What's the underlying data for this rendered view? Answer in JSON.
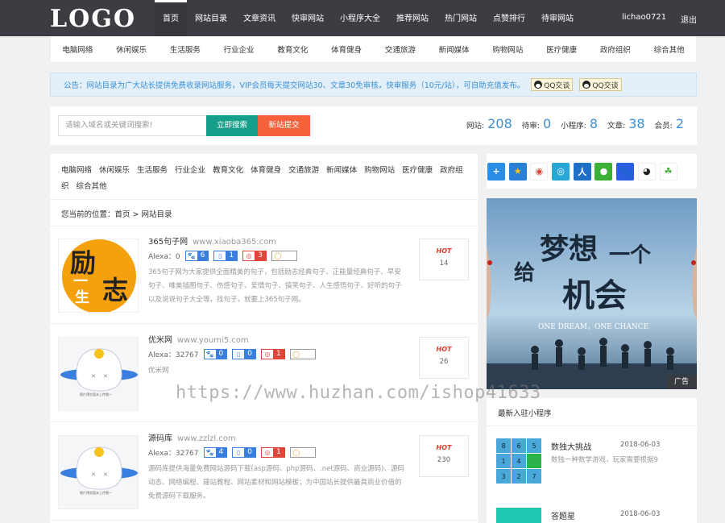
{
  "header": {
    "logo": "LOGO",
    "nav": [
      "首页",
      "网站目录",
      "文章资讯",
      "快审网站",
      "小程序大全",
      "推荐网站",
      "热门网站",
      "点赞排行",
      "待审网站"
    ],
    "active_index": 0,
    "user": "lichao0721",
    "logout": "退出"
  },
  "categories": [
    "电脑网络",
    "休闲娱乐",
    "生活服务",
    "行业企业",
    "教育文化",
    "体育健身",
    "交通旅游",
    "新闻媒体",
    "购物网站",
    "医疗健康",
    "政府组织",
    "综合其他"
  ],
  "notice": {
    "text": "公告：网站目录为广大站长提供免费收录网站服务，VIP会员每天提交网站30、文章30免审核，快审服务（10元/站），可自助充值发布。",
    "qq_buttons": [
      "QQ交谈",
      "QQ交谈"
    ]
  },
  "search": {
    "placeholder": "请输入域名或关键词搜索!",
    "search_label": "立即搜索",
    "submit_label": "新站提交"
  },
  "stats": [
    {
      "label": "网站:",
      "value": "208"
    },
    {
      "label": "待审:",
      "value": "0"
    },
    {
      "label": "小程序:",
      "value": "8"
    },
    {
      "label": "文章:",
      "value": "38"
    },
    {
      "label": "会员:",
      "value": "2"
    }
  ],
  "breadcrumb": "您当前的位置：首页 > 网站目录",
  "sites": [
    {
      "name": "365句子网",
      "url": "www.xiaoba365.com",
      "alexa": "Alexa：0",
      "baidu_weight": "6",
      "baidu_mobile": "1",
      "so_weight": "3",
      "desc": "365句子网为大家提供全面精美的句子，包括励志经典句子、正能量经典句子、早安句子、唯美插图句子、伤感句子、爱情句子、搞笑句子、人生感悟句子、好听的句子以及说说句子大全等，找句子，就要上365句子网。",
      "hot_label": "HOT",
      "hot_count": "14",
      "thumb_chars": [
        "励",
        "志",
        "一",
        "生"
      ]
    },
    {
      "name": "优米网",
      "url": "www.youmi5.com",
      "alexa": "Alexa：32767",
      "baidu_weight": "0",
      "baidu_mobile": "0",
      "so_weight": "1",
      "desc": "优米网",
      "hot_label": "HOT",
      "hot_count": "26",
      "thumb_caption": "图片预览暂未上传哦~"
    },
    {
      "name": "源码库",
      "url": "www.zzlzl.com",
      "alexa": "Alexa：32767",
      "baidu_weight": "4",
      "baidu_mobile": "0",
      "so_weight": "1",
      "desc": "源码库提供海量免费网站源码下载(asp源码、php源码、.net源码、商业源码)、源码动态、网络编程、建站教程、网站素材和网站模板；为中国站长提供最具商业价值的免费源码下载服务。",
      "hot_label": "HOT",
      "hot_count": "230",
      "thumb_caption": "图片预览暂未上传哦~"
    }
  ],
  "banner": {
    "line1": "梦想",
    "line2": "给",
    "line3": "一个",
    "line4": "机会",
    "english": "ONE DREAM，ONE CHANCE",
    "ad_tag": "广告"
  },
  "share_icons": [
    "plus-icon",
    "star-icon",
    "weibo-icon",
    "tencent-weibo-icon",
    "renren-icon",
    "wechat-icon",
    "baidu-icon",
    "qq-icon",
    "clover-icon"
  ],
  "new_apps": {
    "title": "最新入驻小程序",
    "items": [
      {
        "name": "数独大挑战",
        "date": "2018-06-03",
        "desc": "数独一种数学游戏，玩家需要根据9",
        "grid": [
          "8",
          "6",
          "5",
          "1",
          "4",
          "",
          "3",
          "2",
          "7"
        ]
      },
      {
        "name": "答题星",
        "date": "2018-06-03"
      }
    ]
  },
  "watermark": "https://www.huzhan.com/ishop41633",
  "colors": {
    "topbar": "#3b3d42",
    "accent": "#3c8fd4",
    "search_btn": "#16a08c",
    "submit_btn": "#f5613b"
  }
}
